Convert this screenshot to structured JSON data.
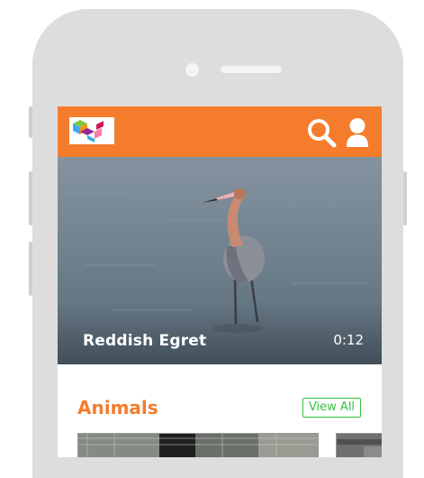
{
  "header": {
    "logo_icon": "colorful-cube-logo-icon",
    "search_icon": "search-icon",
    "profile_icon": "user-profile-icon",
    "background_color": "#f47c2c"
  },
  "hero": {
    "title": "Reddish Egret",
    "duration": "0:12"
  },
  "section": {
    "title": "Animals",
    "view_all_label": "View All",
    "accent_color": "#f47c2c",
    "button_color": "#35c43d"
  }
}
